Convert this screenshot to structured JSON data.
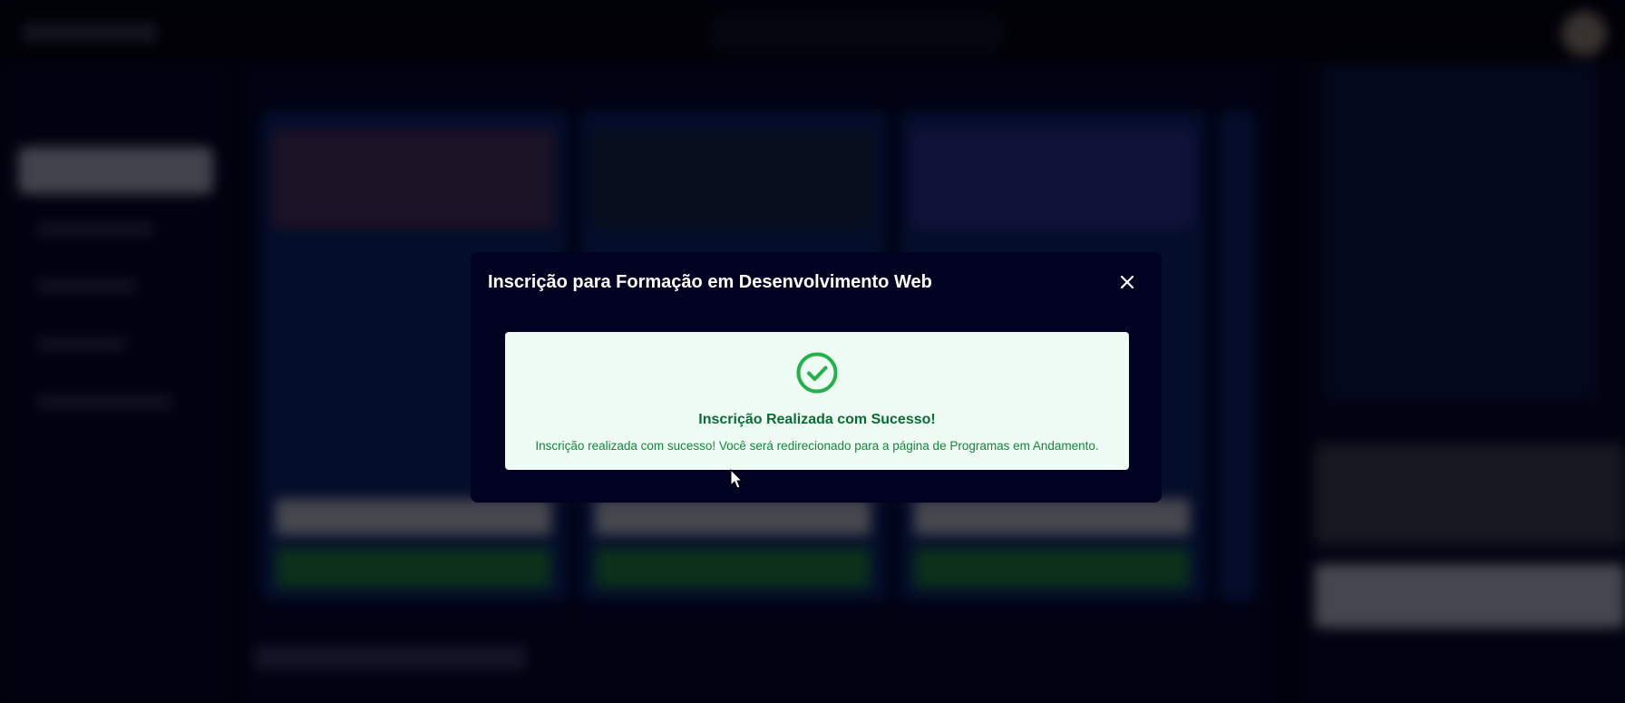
{
  "modal": {
    "title": "Inscrição para Formação em Desenvolvimento Web",
    "success_title": "Inscrição Realizada com Sucesso!",
    "success_message": "Inscrição realizada com sucesso! Você será redirecionado para a página de Programas em Andamento.",
    "icons": {
      "close": "close-icon",
      "status": "check-circle-icon"
    }
  },
  "colors": {
    "modal_bg": "#010221",
    "success_bg": "#effcf3",
    "success_green": "#0b6b35",
    "check_green": "#22b14c"
  }
}
